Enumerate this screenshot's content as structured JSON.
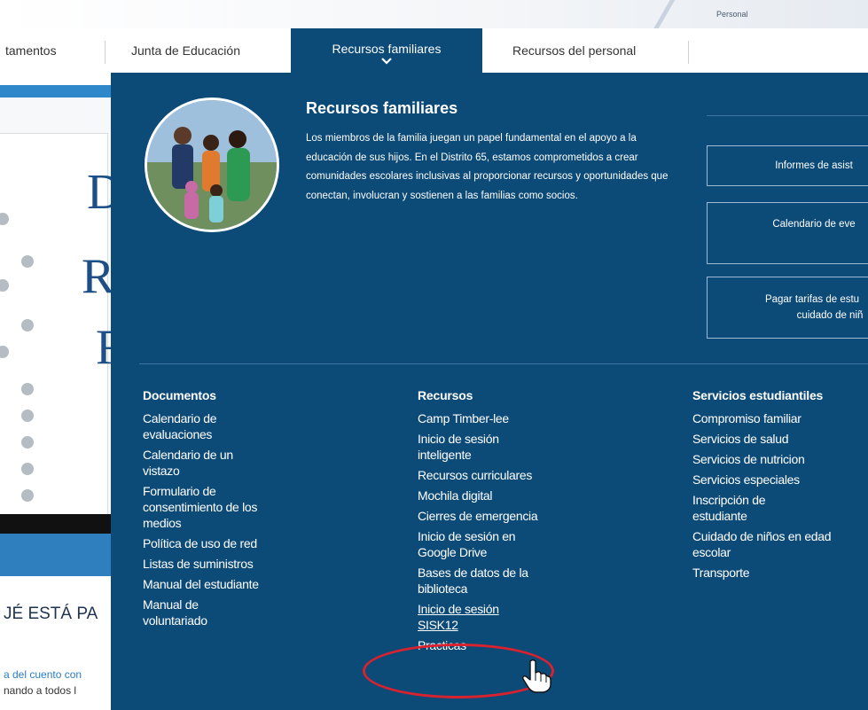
{
  "header": {
    "personal_label": "Personal"
  },
  "nav": {
    "items": [
      {
        "label": "tamentos"
      },
      {
        "label": "Junta de Educación"
      },
      {
        "label": "Recursos familiares",
        "active": true
      },
      {
        "label": "Recursos del personal"
      }
    ]
  },
  "background_page": {
    "big_letters": [
      "D",
      "R",
      "R"
    ],
    "heading": "JÉ ESTÁ PA",
    "line1": "a del cuento con",
    "line2": "nando a todos l"
  },
  "menu": {
    "title": "Recursos familiares",
    "description": "Los miembros de la familia juegan un papel fundamental en el apoyo a la educación de sus hijos. En el Distrito 65, estamos comprometidos a crear comunidades escolares inclusivas al proporcionar recursos y oportunidades que conectan, involucran y sostienen a las familias como socios.",
    "quick_buttons": [
      {
        "label": "Informes de asist"
      },
      {
        "label": "Calendario de eve"
      },
      {
        "label": "Pagar tarifas de estu",
        "label2": "cuidado de niñ"
      }
    ],
    "columns": [
      {
        "heading": "Documentos",
        "links": [
          "Calendario de evaluaciones",
          "Calendario de un vistazo",
          "Formulario de consentimiento de los medios",
          "Política de uso de red",
          "Listas de suministros",
          "Manual del estudiante",
          "Manual de voluntariado"
        ]
      },
      {
        "heading": "Recursos",
        "links": [
          "Camp Timber-lee",
          "Inicio de sesión inteligente",
          "Recursos curriculares",
          "Mochila digital",
          "Cierres de emergencia",
          "Inicio de sesión en Google Drive",
          "Bases de datos de la biblioteca",
          "Inicio de sesión SISK12",
          "Practicas"
        ]
      },
      {
        "heading": "Servicios estudiantiles",
        "links": [
          "Compromiso familiar",
          "Servicios de salud",
          "Servicios de nutricion",
          "Servicios especiales",
          "Inscripción de estudiante",
          "Cuidado de niños en edad escolar",
          "Transporte"
        ]
      }
    ]
  },
  "colors": {
    "panel": "#0c4a78",
    "highlight": "#d8222f"
  }
}
